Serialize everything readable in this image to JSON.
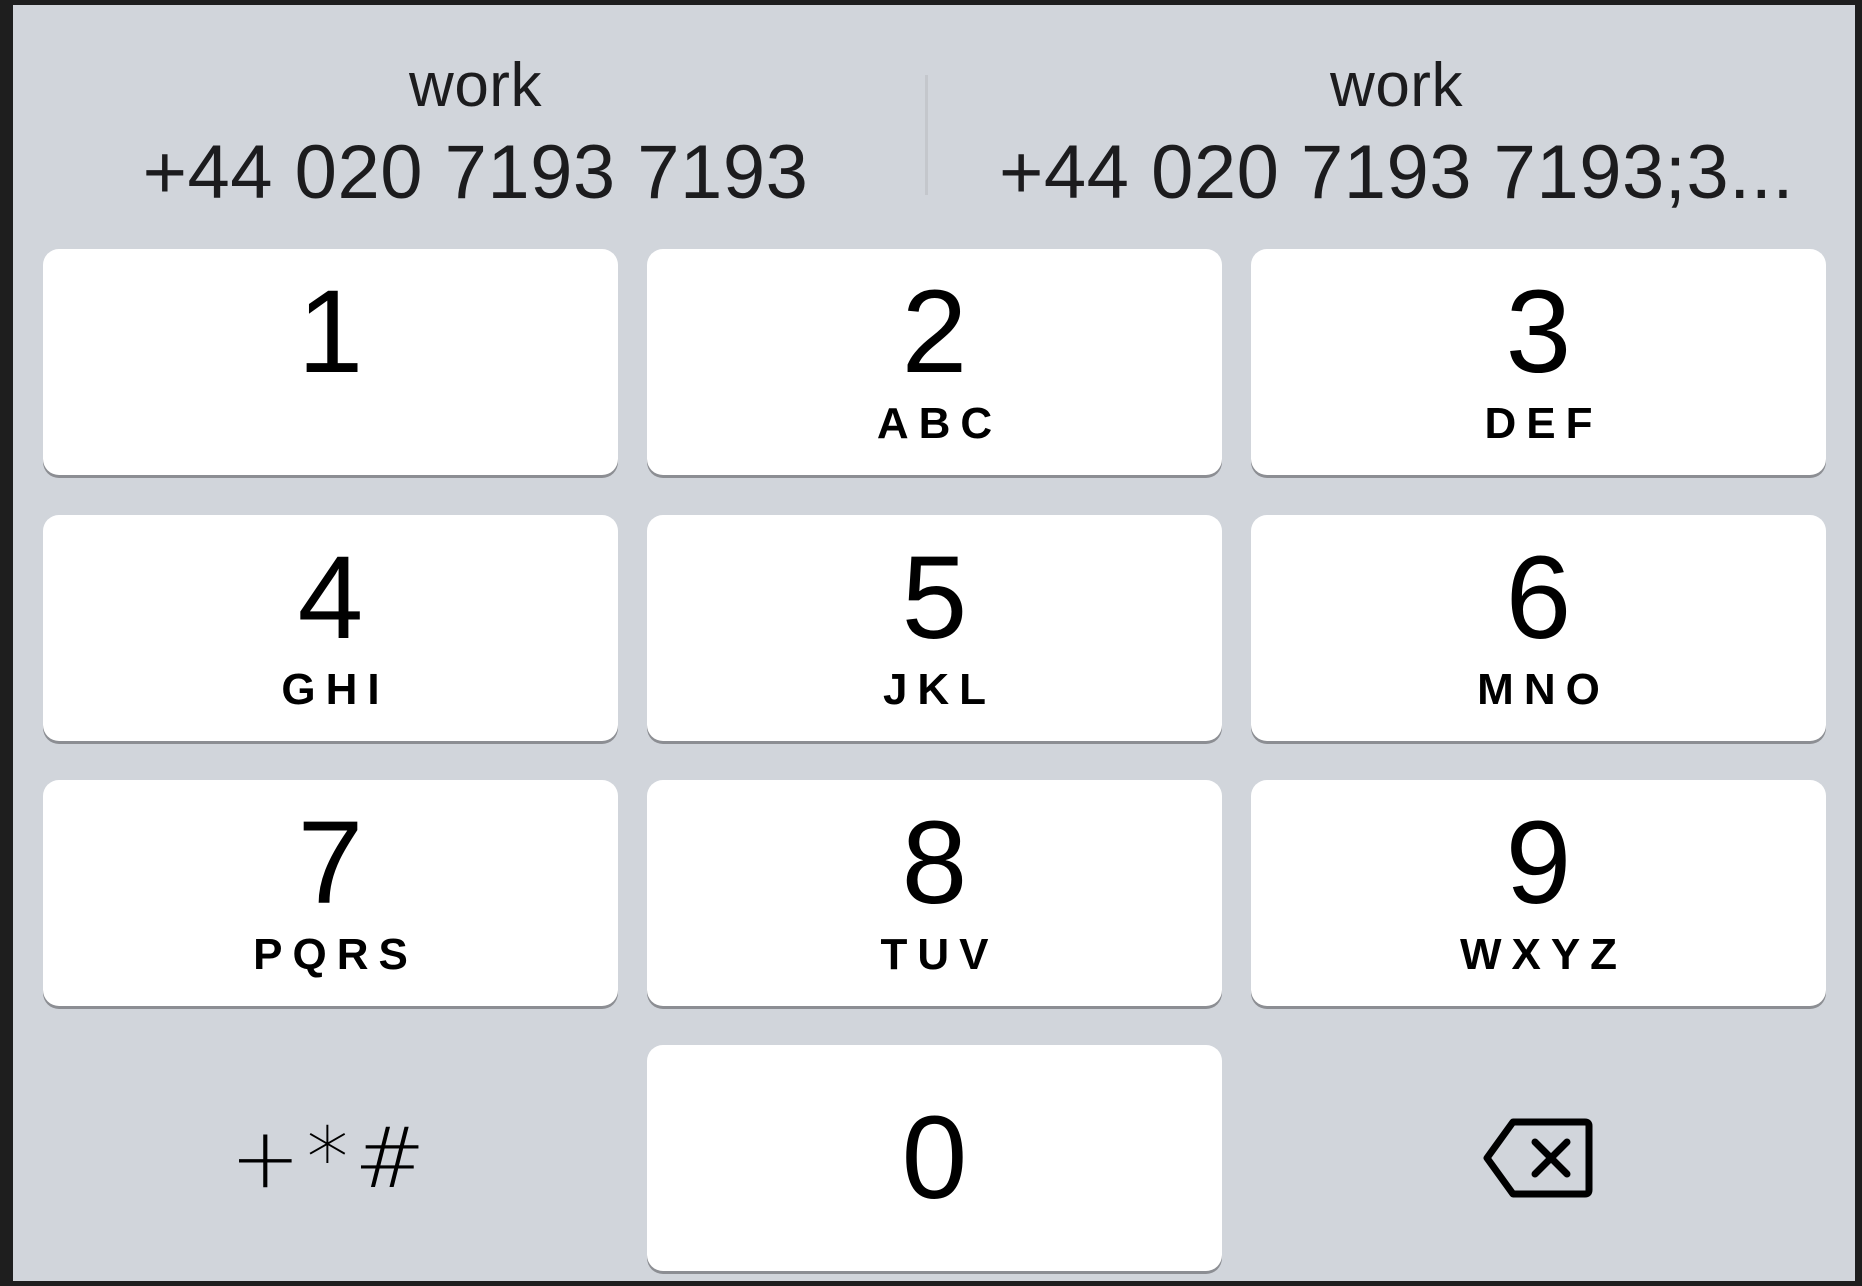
{
  "suggestions": [
    {
      "label": "work",
      "number": "+44 020 7193 7193"
    },
    {
      "label": "work",
      "number": "+44 020  7193 7193;3..."
    }
  ],
  "keys": [
    {
      "digit": "1",
      "letters": ""
    },
    {
      "digit": "2",
      "letters": "ABC"
    },
    {
      "digit": "3",
      "letters": "DEF"
    },
    {
      "digit": "4",
      "letters": "GHI"
    },
    {
      "digit": "5",
      "letters": "JKL"
    },
    {
      "digit": "6",
      "letters": "MNO"
    },
    {
      "digit": "7",
      "letters": "PQRS"
    },
    {
      "digit": "8",
      "letters": "TUV"
    },
    {
      "digit": "9",
      "letters": "WXYZ"
    },
    {
      "digit": "0",
      "letters": ""
    }
  ],
  "bottom_row": {
    "symbols_label": "+*#",
    "delete_icon": "backspace-icon"
  },
  "colors": {
    "background": "#d1d5db",
    "key": "#ffffff",
    "key_shadow": "#8c8e93",
    "text": "#000000"
  }
}
